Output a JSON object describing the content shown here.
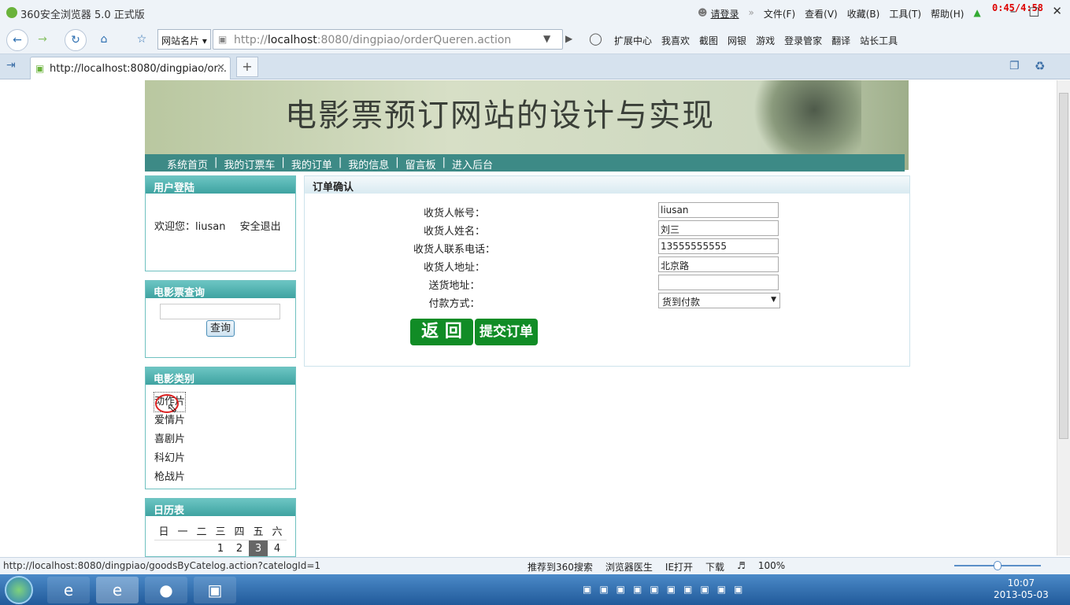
{
  "window": {
    "app_title": "360安全浏览器 5.0 正式版",
    "login_link": "请登录",
    "menu": [
      "文件(F)",
      "查看(V)",
      "收藏(B)",
      "工具(T)",
      "帮助(H)"
    ],
    "timer": "0:45/4:58"
  },
  "navbar": {
    "site_card": "网站名片",
    "url_prefix": "http://",
    "url_host": "localhost",
    "url_rest": ":8080/dingpiao/orderQueren.action",
    "tools": [
      "扩展中心",
      "我喜欢",
      "截图",
      "网银",
      "游戏",
      "登录管家",
      "翻译",
      "站长工具"
    ]
  },
  "tabs": [
    {
      "label": "http://localhost:8080/dingpiao/or..."
    }
  ],
  "page": {
    "site_title": "电影票预订网站的设计与实现",
    "menu": [
      "系统首页",
      "我的订票车",
      "我的订单",
      "我的信息",
      "留言板",
      "进入后台"
    ],
    "login_box": {
      "title": "用户登陆",
      "welcome": "欢迎您：",
      "username": "liusan",
      "logout": "安全退出"
    },
    "search_box": {
      "title": "电影票查询",
      "button": "查询",
      "value": ""
    },
    "category_box": {
      "title": "电影类别",
      "items": [
        "动作片",
        "爱情片",
        "喜剧片",
        "科幻片",
        "枪战片"
      ]
    },
    "calendar": {
      "title": "日历表",
      "weekdays": [
        "日",
        "一",
        "二",
        "三",
        "四",
        "五",
        "六"
      ],
      "first_row": [
        "",
        "",
        "",
        "1",
        "2",
        "3",
        "4"
      ],
      "today": "3"
    },
    "order": {
      "title": "订单确认",
      "fields": [
        {
          "label": "收货人帐号：",
          "value": "liusan"
        },
        {
          "label": "收货人姓名：",
          "value": "刘三"
        },
        {
          "label": "收货人联系电话：",
          "value": "13555555555"
        },
        {
          "label": "收货人地址：",
          "value": "北京路"
        },
        {
          "label": "送货地址：",
          "value": ""
        }
      ],
      "payment_label": "付款方式：",
      "payment_value": "货到付款",
      "back_button": "返 回",
      "submit_button": "提交订单"
    }
  },
  "statusbar": {
    "url": "http://localhost:8080/dingpiao/goodsByCatelog.action?catelogId=1",
    "items": [
      "推荐到360搜索",
      "浏览器医生",
      "IE打开",
      "下载",
      "100%"
    ]
  },
  "taskbar": {
    "time": "10:07",
    "date": "2013-05-03"
  }
}
